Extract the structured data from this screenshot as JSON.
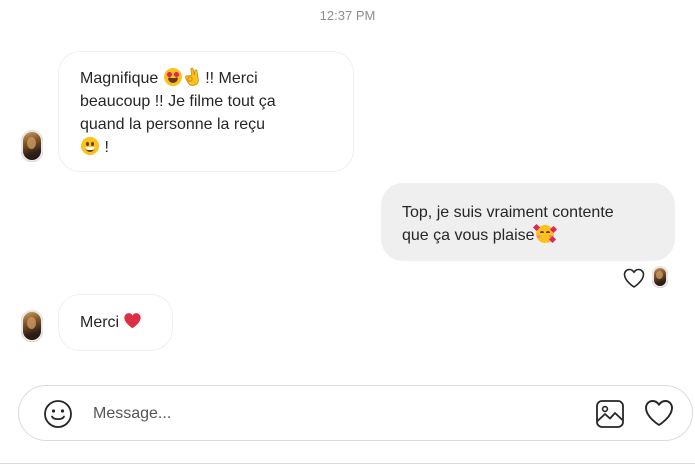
{
  "conversation": {
    "timestamp": "12:37 PM",
    "messages": [
      {
        "direction": "received",
        "line1_a": "Magnifique",
        "line1_b": "!! Merci",
        "line2": "beaucoup !! Je filme tout ça",
        "line3": "quand la personne la reçu",
        "line4": "!",
        "emojis": [
          "heart-eyes-emoji",
          "ok-hand-emoji",
          "grinning-emoji"
        ]
      },
      {
        "direction": "sent",
        "line1": "Top, je suis vraiment contente",
        "line2": "que ça vous plaise",
        "emojis": [
          "smiling-face-with-hearts-emoji"
        ]
      },
      {
        "direction": "received",
        "text": "Merci",
        "emojis": [
          "red-heart-emoji"
        ]
      }
    ],
    "seen_indicator": {
      "icons": [
        "heart-outline-icon",
        "avatar"
      ]
    }
  },
  "composer": {
    "placeholder": "Message...",
    "value": "",
    "icons": [
      "smiley-icon",
      "image-icon",
      "heart-outline-icon"
    ]
  },
  "colors": {
    "sent_bubble": "#efefef",
    "received_border": "#efefef",
    "text": "#262626",
    "timestamp": "#8e8e8e",
    "heart_red": "#e0245e"
  }
}
